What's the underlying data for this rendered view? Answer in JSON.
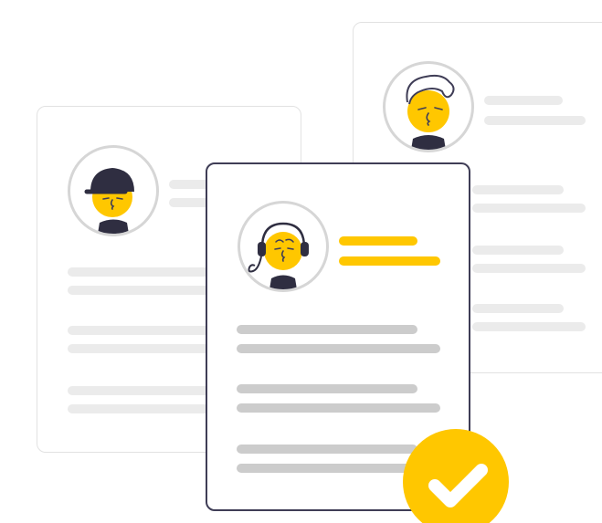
{
  "illustration": {
    "subject": "selected-profile-card",
    "colors": {
      "accent": "#ffc700",
      "outline": "#3f3d56",
      "line_light": "#ebebeb",
      "line_medium": "#cccccc",
      "card_border_back": "#e2e2e2",
      "avatar_ring": "#d6d6d6"
    },
    "icons": {
      "front_card_avatar": "headset-person-icon",
      "left_card_avatar": "cap-person-icon",
      "right_card_avatar": "curly-hair-person-icon",
      "badge": "checkmark-icon"
    }
  }
}
